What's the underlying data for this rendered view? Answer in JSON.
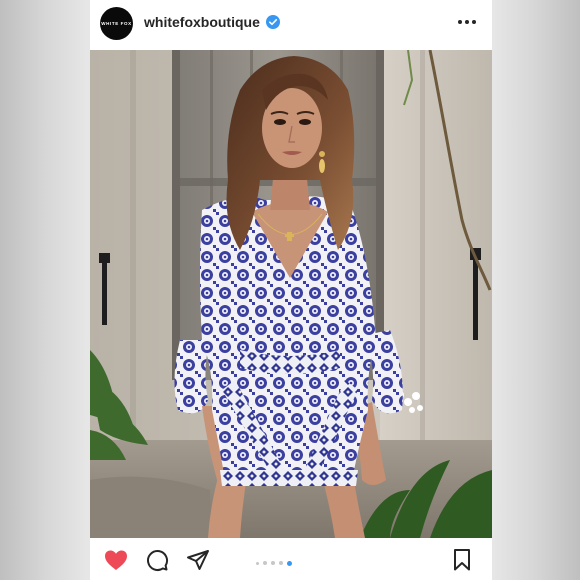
{
  "post": {
    "account": {
      "username": "whitefoxboutique",
      "avatar_text": "WHITE FOX",
      "verified": true,
      "verified_color": "#3897f0"
    },
    "icons": {
      "more": "more-options-icon",
      "like": "heart-icon",
      "comment": "comment-icon",
      "share": "send-icon",
      "save": "bookmark-icon"
    },
    "like_color": "#ed4956",
    "carousel": {
      "total": 5,
      "active_index": 4,
      "active_color": "#3897f0"
    }
  }
}
